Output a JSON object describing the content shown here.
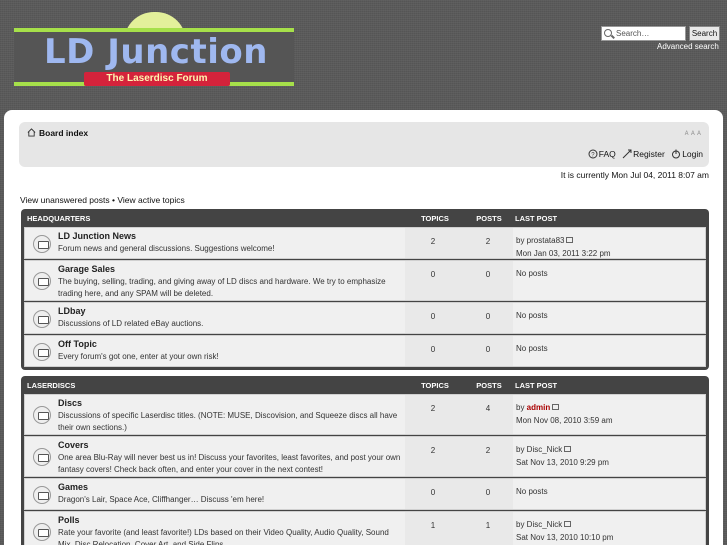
{
  "header": {
    "logo_title": "LD Junction",
    "logo_subtitle": "The Laserdisc Forum",
    "search_placeholder": "Search…",
    "search_button": "Search",
    "advanced_search": "Advanced search"
  },
  "navbar": {
    "board_index": "Board index",
    "font_size": "ᴀ ᴀ ᴀ",
    "faq": "FAQ",
    "register": "Register",
    "login": "Login"
  },
  "time_text": "It is currently Mon Jul 04, 2011 8:07 am",
  "quicklinks": {
    "unanswered": "View unanswered posts",
    "bullet": "•",
    "active": "View active topics"
  },
  "colors": {
    "logo_accent": "#a6e04a",
    "logo_red": "#d4233b",
    "admin_name": "#aa0000"
  },
  "categories": [
    {
      "name": "Headquarters",
      "col_topics": "Topics",
      "col_posts": "Posts",
      "col_last": "Last post",
      "forums": [
        {
          "title": "LD Junction News",
          "desc": "Forum news and general discussions. Suggestions welcome!",
          "topics": "2",
          "posts": "2",
          "last_by": "by prostata83",
          "last_user": "",
          "last_date": "Mon Jan 03, 2011 3:22 pm"
        },
        {
          "title": "Garage Sales",
          "desc": "The buying, selling, trading, and giving away of LD discs and hardware. We try to emphasize trading here, and any SPAM will be deleted.",
          "topics": "0",
          "posts": "0",
          "last_by": "No posts",
          "last_user": "",
          "last_date": ""
        },
        {
          "title": "LDbay",
          "desc": "Discussions of LD related eBay auctions.",
          "topics": "0",
          "posts": "0",
          "last_by": "No posts",
          "last_user": "",
          "last_date": ""
        },
        {
          "title": "Off Topic",
          "desc": "Every forum's got one, enter at your own risk!",
          "topics": "0",
          "posts": "0",
          "last_by": "No posts",
          "last_user": "",
          "last_date": ""
        }
      ]
    },
    {
      "name": "Laserdiscs",
      "col_topics": "Topics",
      "col_posts": "Posts",
      "col_last": "Last post",
      "forums": [
        {
          "title": "Discs",
          "desc": "Discussions of specific Laserdisc titles. (NOTE: MUSE, Discovision, and Squeeze discs all have their own sections.)",
          "topics": "2",
          "posts": "4",
          "last_by": "by ",
          "last_user": "admin",
          "last_date": "Mon Nov 08, 2010 3:59 am"
        },
        {
          "title": "Covers",
          "desc": "One area Blu-Ray will never best us in! Discuss your favorites, least favorites, and post your own fantasy covers! Check back often, and enter your cover in the next contest!",
          "topics": "2",
          "posts": "2",
          "last_by": "by Disc_Nick",
          "last_user": "",
          "last_date": "Sat Nov 13, 2010 9:29 pm"
        },
        {
          "title": "Games",
          "desc": "Dragon's Lair, Space Ace, Cliffhanger… Discuss 'em here!",
          "topics": "0",
          "posts": "0",
          "last_by": "No posts",
          "last_user": "",
          "last_date": ""
        },
        {
          "title": "Polls",
          "desc": "Rate your favorite (and least favorite!) LDs based on their Video Quality, Audio Quality, Sound Mix, Disc Relocation, Cover Art, and Side Flips.",
          "topics": "1",
          "posts": "1",
          "last_by": "by Disc_Nick",
          "last_user": "",
          "last_date": "Sat Nov 13, 2010 10:10 pm"
        }
      ]
    }
  ]
}
